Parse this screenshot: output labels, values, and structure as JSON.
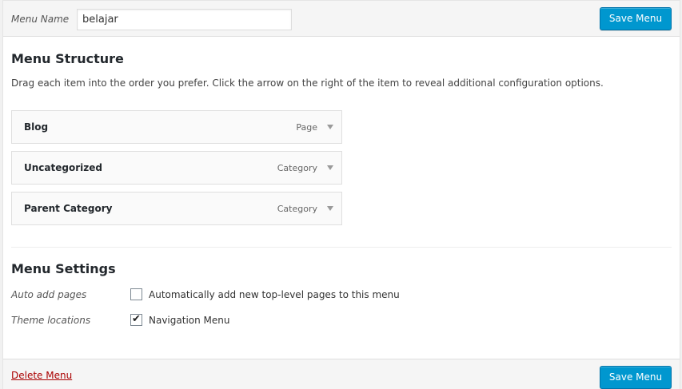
{
  "header": {
    "menu_name_label": "Menu Name",
    "menu_name_value": "belajar",
    "save_label": "Save Menu"
  },
  "structure": {
    "title": "Menu Structure",
    "description": "Drag each item into the order you prefer. Click the arrow on the right of the item to reveal additional configuration options.",
    "items": [
      {
        "title": "Blog",
        "type": "Page"
      },
      {
        "title": "Uncategorized",
        "type": "Category"
      },
      {
        "title": "Parent Category",
        "type": "Category"
      }
    ]
  },
  "settings": {
    "title": "Menu Settings",
    "auto_add_label": "Auto add pages",
    "auto_add_text": "Automatically add new top-level pages to this menu",
    "auto_add_checked": false,
    "theme_locations_label": "Theme locations",
    "nav_menu_text": "Navigation Menu",
    "nav_menu_checked": true
  },
  "footer": {
    "delete_label": "Delete Menu",
    "save_label": "Save Menu"
  },
  "colors": {
    "primary_button": "#0097cf",
    "delete_link": "#aa0000"
  }
}
